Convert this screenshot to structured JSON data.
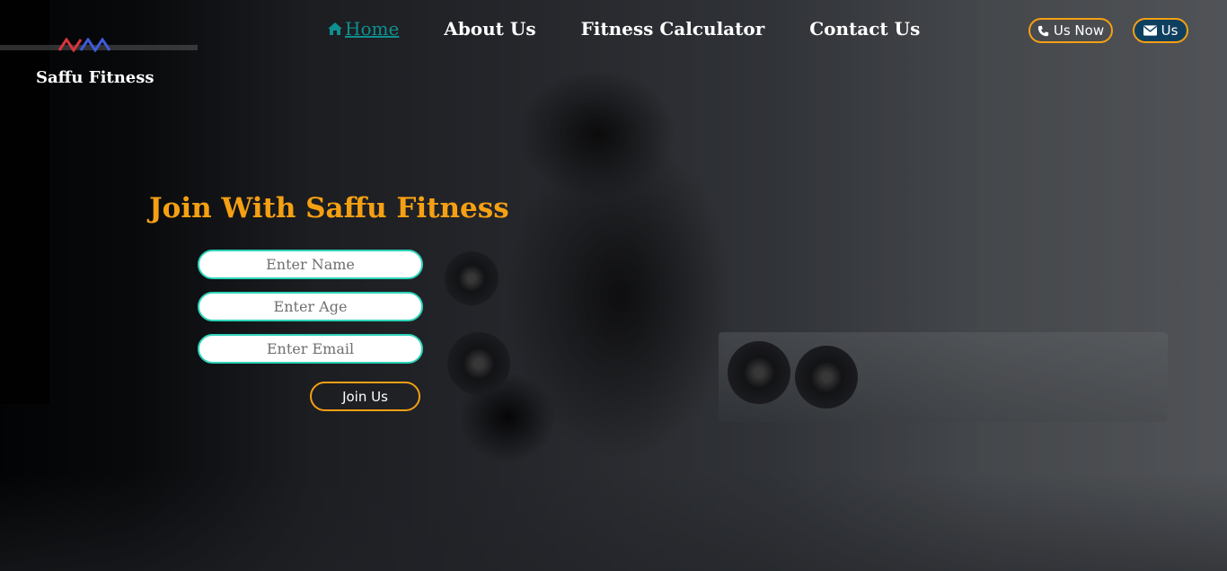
{
  "brand": {
    "name": "Saffu Fitness",
    "logo_icon": "saffu-logo-mark"
  },
  "nav": {
    "items": [
      {
        "label": "Home",
        "icon": "home-icon",
        "active": true
      },
      {
        "label": "About Us",
        "active": false
      },
      {
        "label": "Fitness Calculator",
        "active": false
      },
      {
        "label": "Contact Us",
        "active": false
      }
    ]
  },
  "actions": {
    "call_label": "Us Now",
    "call_icon": "phone-icon",
    "mail_label": "Us",
    "mail_icon": "envelope-icon"
  },
  "join": {
    "title": "Join With Saffu Fitness",
    "name_placeholder": "Enter Name",
    "age_placeholder": "Enter Age",
    "email_placeholder": "Enter Email",
    "submit_label": "Join Us"
  },
  "colors": {
    "accent": "#f5a013",
    "active_link": "#0f8f8f",
    "input_border": "#2ed3b8",
    "mail_button_bg": "#0f3f5f",
    "logo_red": "#d8343c",
    "logo_blue": "#3d5bd9"
  }
}
